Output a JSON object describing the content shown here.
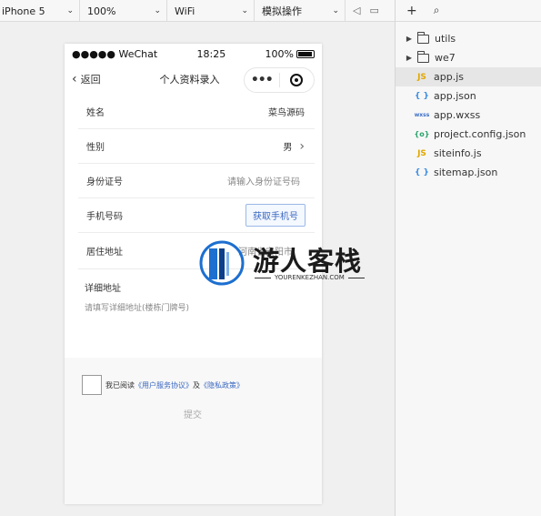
{
  "toolbar": {
    "device": "iPhone 5",
    "zoom": "100%",
    "network": "WiFi",
    "mode": "模拟操作"
  },
  "file_tree": {
    "items": [
      {
        "name": "utils",
        "type": "folder"
      },
      {
        "name": "we7",
        "type": "folder"
      },
      {
        "name": "app.js",
        "type": "js"
      },
      {
        "name": "app.json",
        "type": "json"
      },
      {
        "name": "app.wxss",
        "type": "wxss"
      },
      {
        "name": "project.config.json",
        "type": "config"
      },
      {
        "name": "siteinfo.js",
        "type": "js"
      },
      {
        "name": "sitemap.json",
        "type": "json"
      }
    ],
    "icons": {
      "js": "JS",
      "json": "{ }",
      "wxss": "wxss",
      "config": "{o}"
    }
  },
  "phone": {
    "status": {
      "carrier": "●●●●● WeChat",
      "time": "18:25",
      "battery": "100%"
    },
    "nav": {
      "back": "返回",
      "title": "个人资料录入",
      "more": "•••"
    },
    "form": {
      "name_label": "姓名",
      "name_value": "菜鸟源码",
      "gender_label": "性别",
      "gender_value": "男",
      "id_label": "身份证号",
      "id_placeholder": "请输入身份证号码",
      "phone_label": "手机号码",
      "phone_button": "获取手机号",
      "residence_label": "居住地址",
      "residence_value": "河南省安阳市",
      "address_label": "详细地址",
      "address_placeholder": "请填写详细地址(楼栋门牌号)"
    },
    "agreement": {
      "prefix": "我已阅读",
      "link1": "《用户服务协议》",
      "and": "及",
      "link2": "《隐私政策》"
    },
    "submit": "提交"
  },
  "watermark": {
    "title": "游人客栈",
    "subtitle": "YOURENKEZHAN.COM"
  },
  "colors": {
    "accent": "#3a68c0",
    "js": "#e0a800",
    "json": "#3b8de0"
  }
}
